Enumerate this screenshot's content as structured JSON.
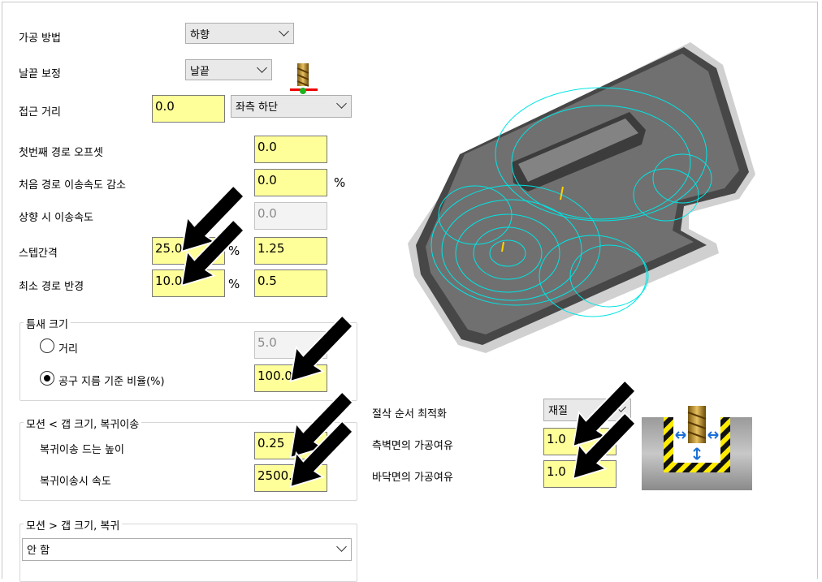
{
  "form": {
    "method": {
      "label": "가공 방법",
      "value": "하향"
    },
    "edge_comp": {
      "label": "날끝 보정",
      "value": "날끝"
    },
    "approach": {
      "label": "접근 거리",
      "value": "0.0",
      "position_value": "좌측 하단"
    },
    "first_offset": {
      "label": "첫번째 경로 오프셋",
      "value": "0.0"
    },
    "first_feed_reduce": {
      "label": "처음 경로 이송속도 감소",
      "value": "0.0",
      "unit": "%"
    },
    "up_feed": {
      "label": "상향 시 이송속도",
      "value": "0.0"
    },
    "stepover": {
      "label": "스텝간격",
      "value": "25.0",
      "unit": "%",
      "value2": "1.25"
    },
    "min_radius": {
      "label": "최소 경로 반경",
      "value": "10.0",
      "unit": "%",
      "value2": "0.5"
    }
  },
  "gap_group": {
    "title": "틈새 크기",
    "distance": {
      "label": "거리",
      "value": "5.0",
      "selected": false
    },
    "ratio": {
      "label": "공구 지름 기준 비율(%)",
      "value": "100.0",
      "selected": true
    }
  },
  "motion_lt": {
    "title": "모션 < 갭 크기, 복귀이송",
    "retract_height": {
      "label": "복귀이송 드는 높이",
      "value": "0.25"
    },
    "retract_feed": {
      "label": "복귀이송시 속도",
      "value": "2500.0"
    }
  },
  "motion_gt": {
    "title": "모션 > 갭 크기, 복귀",
    "value": "안 함"
  },
  "right": {
    "order": {
      "label": "절삭 순서 최적화",
      "value": "재질"
    },
    "wall_stock": {
      "label": "측벽면의 가공여유",
      "value": "1.0"
    },
    "floor_stock": {
      "label": "바닥면의 가공여유",
      "value": "1.0"
    }
  },
  "colors": {
    "field": "#ffff99",
    "toolpath": "#00e5e5",
    "part": "#6e6e6e"
  }
}
